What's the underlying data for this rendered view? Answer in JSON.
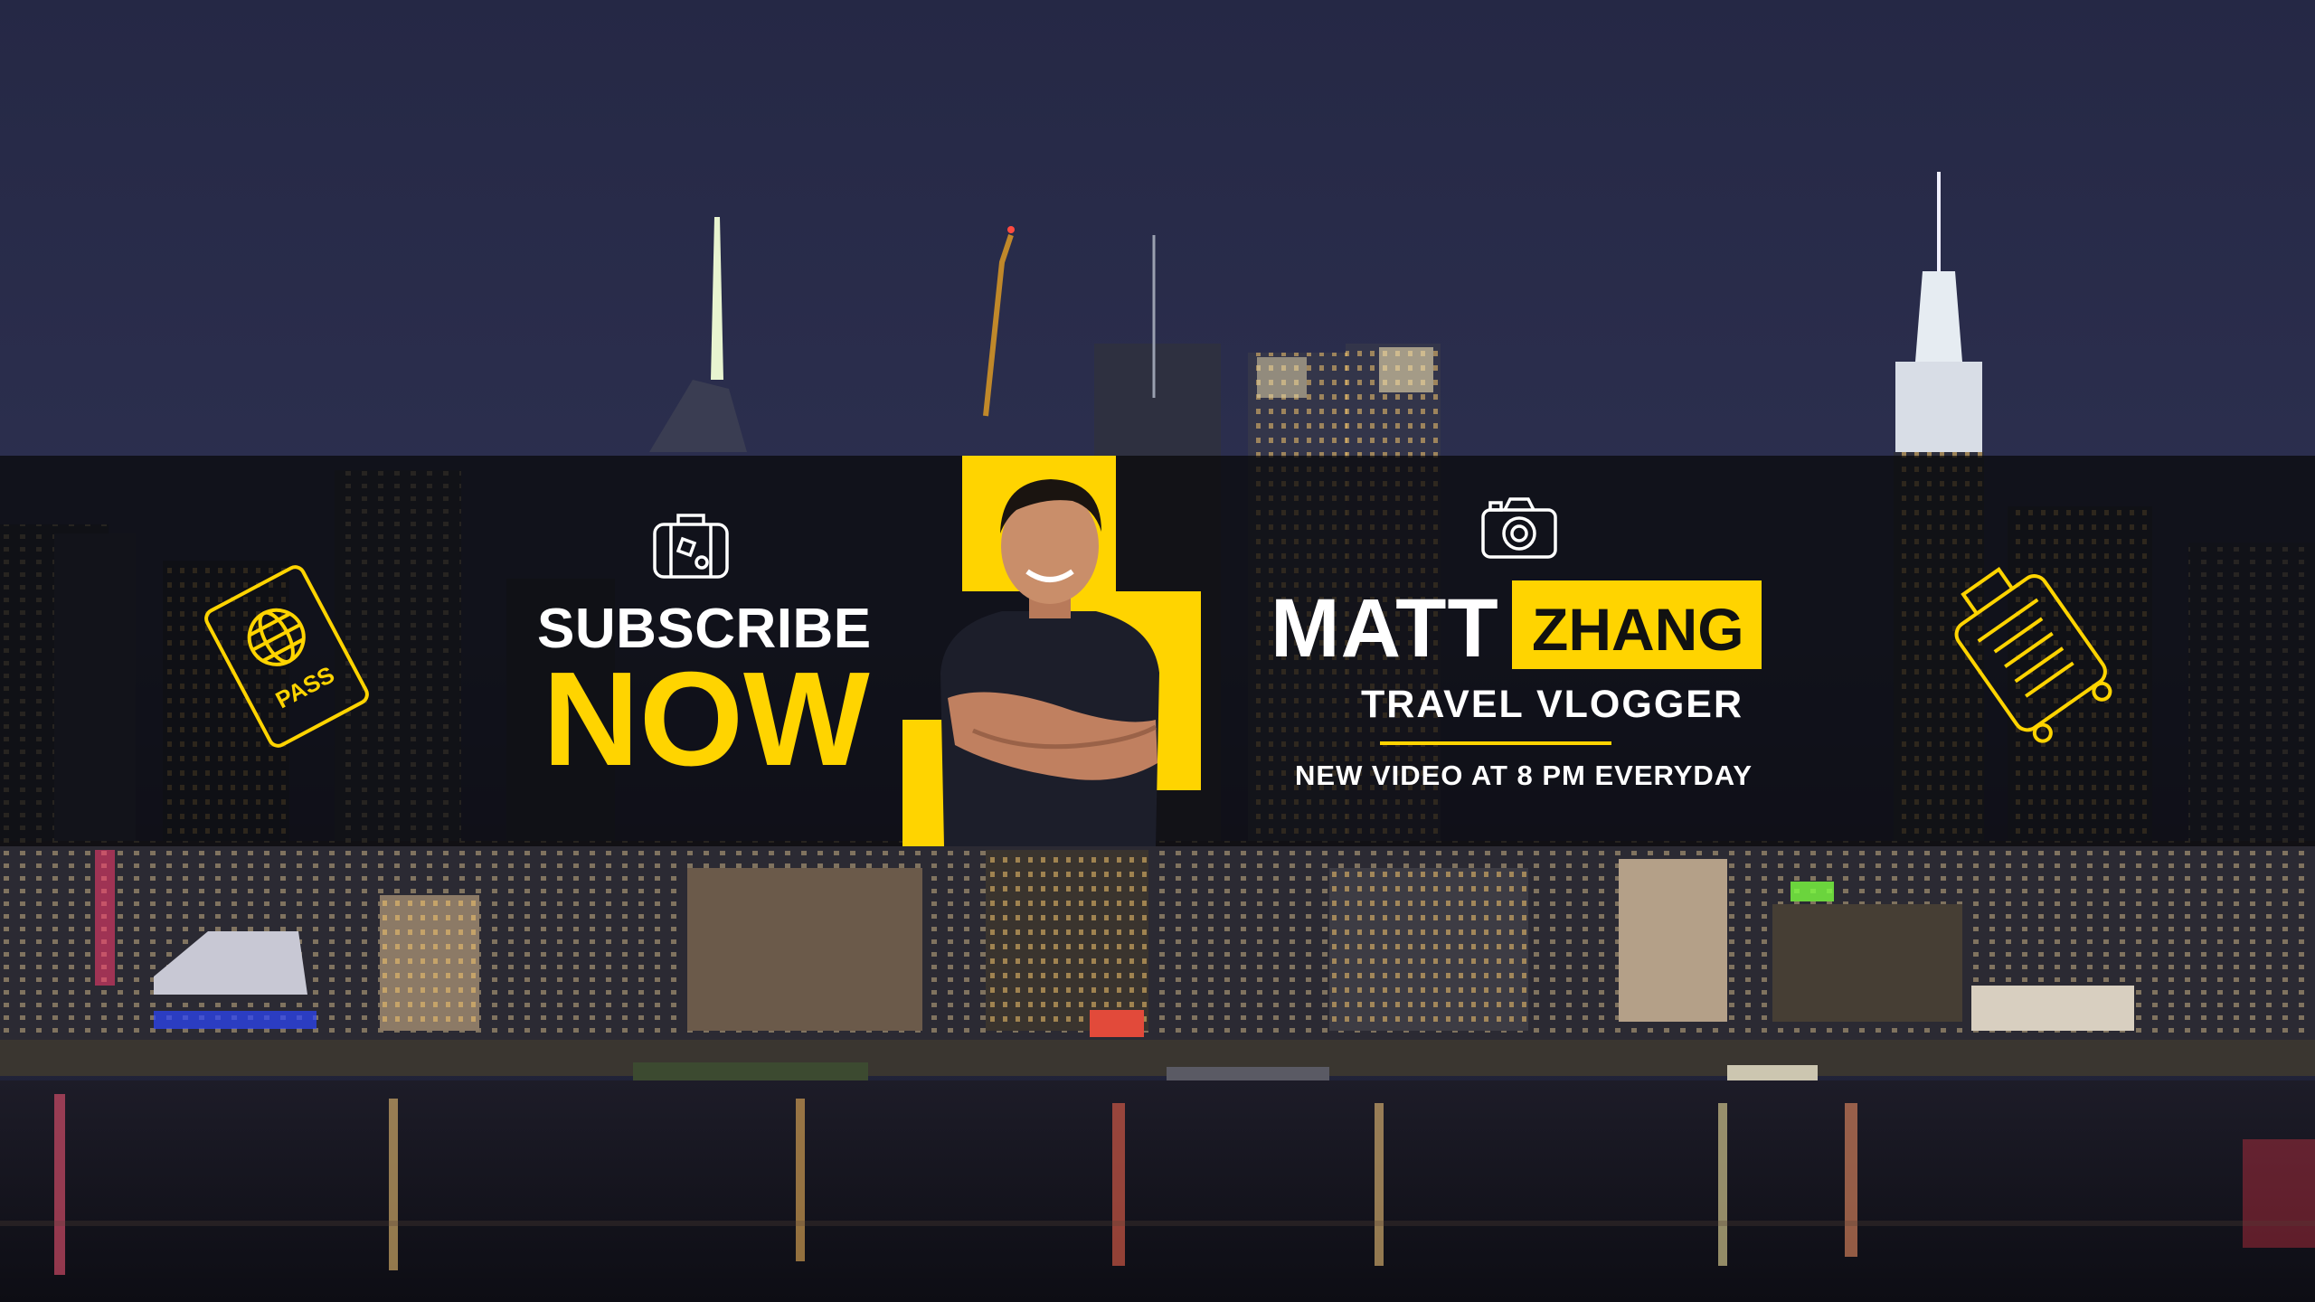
{
  "banner": {
    "cta_line1": "SUBSCRIBE",
    "cta_line2": "NOW",
    "first_name": "MATT",
    "last_name": "ZHANG",
    "role": "TRAVEL VLOGGER",
    "schedule": "NEW VIDEO AT 8 PM EVERYDAY",
    "passport_label": "PASS"
  },
  "colors": {
    "accent": "#ffd400",
    "banner_overlay": "#08080a",
    "text": "#ffffff",
    "sky": "#252845"
  },
  "icons": [
    "passport-icon",
    "globe-icon",
    "suitcase-icon",
    "camera-icon",
    "rolling-luggage-icon"
  ]
}
